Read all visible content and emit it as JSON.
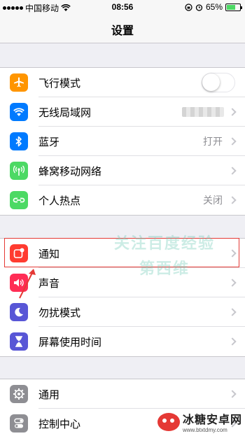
{
  "status_bar": {
    "carrier": "中国移动",
    "time": "08:56",
    "battery_percent": "65%",
    "battery_level": 0.65,
    "battery_color": "#4cd964"
  },
  "nav": {
    "title": "设置"
  },
  "groups": [
    {
      "items": [
        {
          "label": "飞行模式",
          "icon": "airplane-icon",
          "color": "#ff9500",
          "accessory": "toggle",
          "toggle_on": false
        },
        {
          "label": "无线局域网",
          "icon": "wifi-icon",
          "color": "#007aff",
          "accessory": "chevron",
          "value_redacted": true
        },
        {
          "label": "蓝牙",
          "icon": "bluetooth-icon",
          "color": "#007aff",
          "accessory": "chevron",
          "value": "打开"
        },
        {
          "label": "蜂窝移动网络",
          "icon": "cellular-icon",
          "color": "#4cd964",
          "accessory": "chevron"
        },
        {
          "label": "个人热点",
          "icon": "hotspot-icon",
          "color": "#4cd964",
          "accessory": "chevron",
          "value": "关闭"
        }
      ]
    },
    {
      "items": [
        {
          "label": "通知",
          "icon": "notification-icon",
          "color": "#ff3b30",
          "accessory": "chevron",
          "highlighted": true
        },
        {
          "label": "声音",
          "icon": "speaker-icon",
          "color": "#ff2d55",
          "accessory": "chevron"
        },
        {
          "label": "勿扰模式",
          "icon": "moon-icon",
          "color": "#5856d6",
          "accessory": "chevron"
        },
        {
          "label": "屏幕使用时间",
          "icon": "hourglass-icon",
          "color": "#5856d6",
          "accessory": "chevron"
        }
      ]
    },
    {
      "items": [
        {
          "label": "通用",
          "icon": "gear-icon",
          "color": "#8e8e93",
          "accessory": "chevron"
        },
        {
          "label": "控制中心",
          "icon": "toggles-icon",
          "color": "#8e8e93",
          "accessory": "chevron"
        }
      ]
    }
  ],
  "watermark": {
    "line1": "关注百度经验",
    "line2": "第西维"
  },
  "brand": {
    "name": "冰糖安卓网",
    "url": "www.btxtdmy.com"
  },
  "colors": {
    "highlight_border": "#e53935",
    "annotation_arrow": "#e53935"
  }
}
